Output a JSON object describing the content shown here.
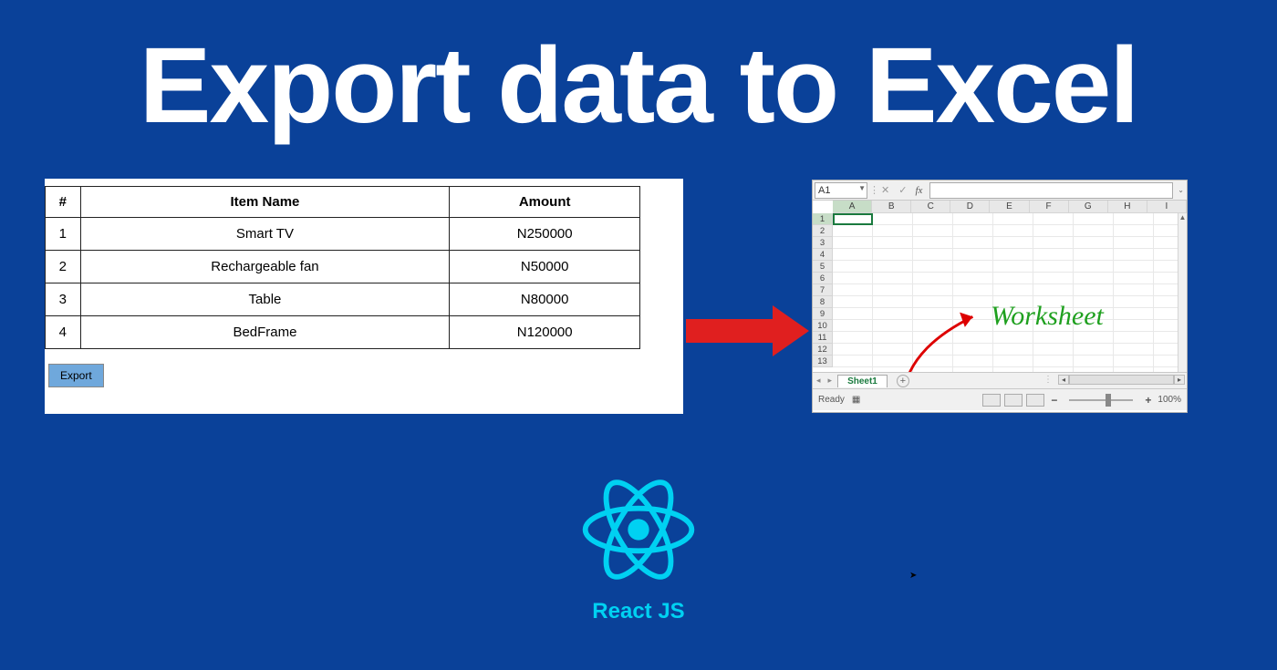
{
  "title": "Export data to Excel",
  "table": {
    "headers": {
      "index": "#",
      "item": "Item Name",
      "amount": "Amount"
    },
    "rows": [
      {
        "index": "1",
        "item": "Smart TV",
        "amount": "N250000"
      },
      {
        "index": "2",
        "item": "Rechargeable fan",
        "amount": "N50000"
      },
      {
        "index": "3",
        "item": "Table",
        "amount": "N80000"
      },
      {
        "index": "4",
        "item": "BedFrame",
        "amount": "N120000"
      }
    ],
    "export_label": "Export"
  },
  "excel": {
    "name_box": "A1",
    "fx_label": "fx",
    "columns": [
      "A",
      "B",
      "C",
      "D",
      "E",
      "F",
      "G",
      "H",
      "I"
    ],
    "rows": [
      "1",
      "2",
      "3",
      "4",
      "5",
      "6",
      "7",
      "8",
      "9",
      "10",
      "11",
      "12",
      "13"
    ],
    "annotation": "Worksheet",
    "sheet_tab": "Sheet1",
    "status_ready": "Ready",
    "zoom": "100%"
  },
  "react": {
    "label": "React JS"
  }
}
